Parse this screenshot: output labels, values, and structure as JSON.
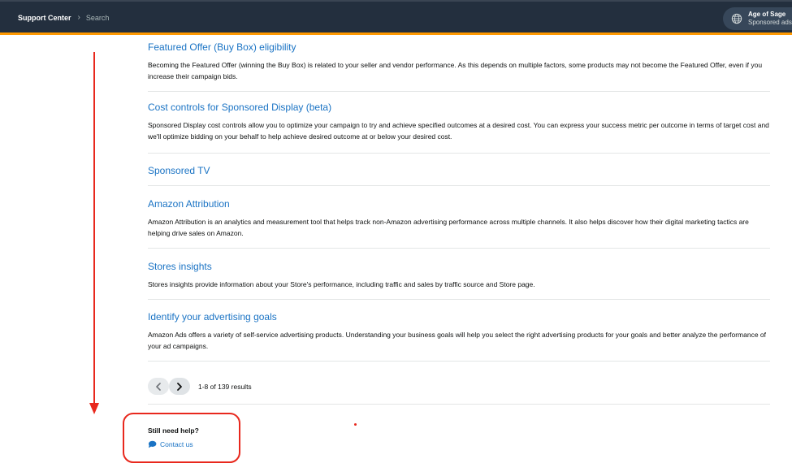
{
  "header": {
    "breadcrumb_home": "Support Center",
    "breadcrumb_separator": "›",
    "breadcrumb_current": "Search",
    "account_name": "Age of Sage",
    "account_sub": "Sponsored ads",
    "account_icon": "globe-icon"
  },
  "results": [
    {
      "title": "Featured Offer (Buy Box) eligibility",
      "summary": "Becoming the Featured Offer (winning the Buy Box) is related to your seller and vendor performance. As this depends on multiple factors, some products may not become the Featured Offer, even if you increase their campaign bids."
    },
    {
      "title": "Cost controls for Sponsored Display (beta)",
      "summary": "Sponsored Display cost controls allow you to optimize your campaign to try and achieve specified outcomes at a desired cost. You can express your success metric per outcome in terms of target cost and we'll optimize bidding on your behalf to help achieve desired outcome at or below your desired cost."
    },
    {
      "title": "Sponsored TV",
      "summary": ""
    },
    {
      "title": "Amazon Attribution",
      "summary": "Amazon Attribution is an analytics and measurement tool that helps track non-Amazon advertising performance across multiple channels. It also helps discover how their digital marketing tactics are helping drive sales on Amazon."
    },
    {
      "title": "Stores insights",
      "summary": "Stores insights provide information about your Store's performance, including traffic and sales by traffic source and Store page."
    },
    {
      "title": "Identify your advertising goals",
      "summary": "Amazon Ads offers a variety of self-service advertising products. Understanding your business goals will help you select the right advertising products for your goals and better analyze the performance of your ad campaigns."
    }
  ],
  "pagination": {
    "results_text": "1-8 of 139 results",
    "prev_icon": "chevron-left-icon",
    "next_icon": "chevron-right-icon"
  },
  "help": {
    "title": "Still need help?",
    "contact_label": "Contact us",
    "contact_icon": "chat-bubble-icon"
  },
  "annotation": {
    "color": "#e8281d"
  },
  "colors": {
    "header_bg": "#232f3e",
    "header_accent": "#ff9900",
    "link": "#1a73c4"
  }
}
